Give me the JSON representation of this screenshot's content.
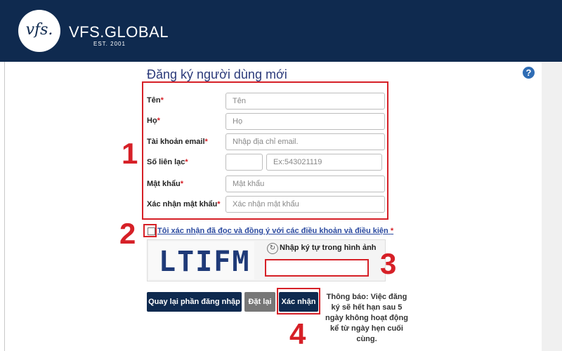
{
  "header": {
    "logo_mark": "vfs.",
    "brand": "VFS.GLOBAL",
    "est": "EST. 2001"
  },
  "help_icon": "?",
  "form": {
    "title": "Đăng ký người dùng mới",
    "fields": {
      "first_name": {
        "label": "Tên",
        "placeholder": "Tên"
      },
      "last_name": {
        "label": "Họ",
        "placeholder": "Họ"
      },
      "email": {
        "label": "Tài khoản email",
        "placeholder": "Nhập địa chỉ email."
      },
      "phone": {
        "label": "Số liên lạc",
        "code_value": "",
        "placeholder": "Ex:543021119"
      },
      "password": {
        "label": "Mật khẩu",
        "placeholder": "Mật khẩu"
      },
      "confirm_password": {
        "label": "Xác nhận mật khẩu",
        "placeholder": "Xác nhận mật khẩu"
      }
    },
    "required_mark": "*",
    "terms_text": "Tôi xác nhận đã đọc và đồng ý với các điều khoản và điều kiện",
    "captcha": {
      "image_text": "LTIFM",
      "label": "Nhập ký tự trong hình ảnh",
      "value": ""
    },
    "buttons": {
      "back_login": "Quay lại phần đăng nhập",
      "reset": "Đặt lại",
      "submit": "Xác nhận"
    },
    "notice": "Thông báo: Việc đăng ký sẽ hết hạn sau 5 ngày không hoạt động kể từ ngày hẹn cuối cùng."
  },
  "annotations": {
    "n1": "1",
    "n2": "2",
    "n3": "3",
    "n4": "4"
  },
  "colors": {
    "header_bg": "#0f2a4f",
    "highlight_red": "#d62027",
    "button_navy": "#0f2a4f",
    "button_gray": "#777777",
    "title_blue": "#2b3a7a"
  },
  "icons": {
    "help": "question-circle-icon",
    "refresh": "refresh-icon"
  }
}
